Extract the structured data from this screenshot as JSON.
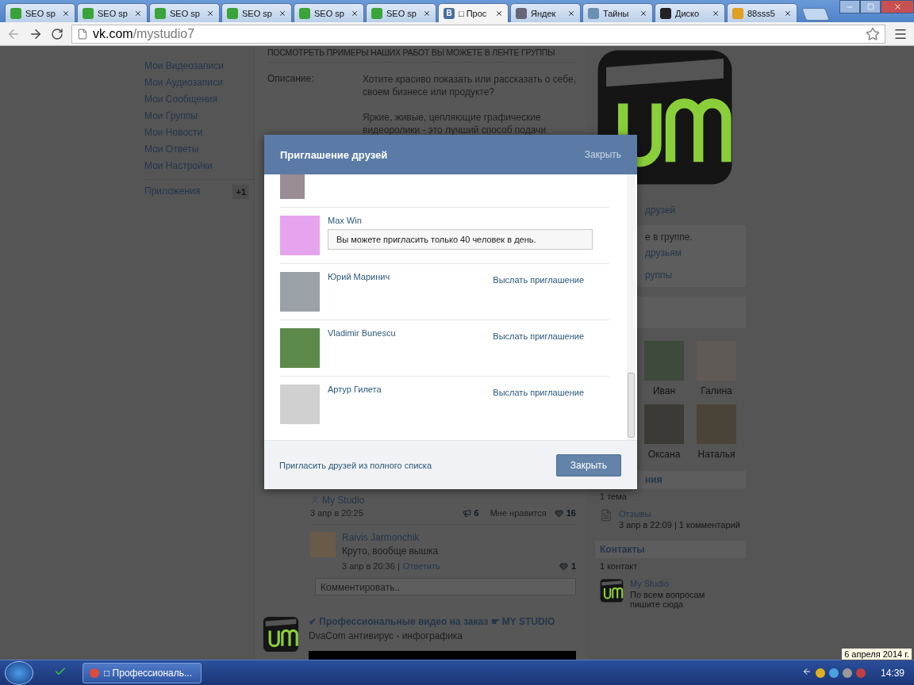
{
  "browser": {
    "tabs": [
      {
        "title": "SEO sp",
        "selected": false
      },
      {
        "title": "SEO sp",
        "selected": false
      },
      {
        "title": "SEO sp",
        "selected": false
      },
      {
        "title": "SEO sp",
        "selected": false
      },
      {
        "title": "SEO sp",
        "selected": false
      },
      {
        "title": "SEO sp",
        "selected": false
      },
      {
        "title": "□ Прос",
        "icon_text": "В",
        "selected": true
      },
      {
        "title": "Яндек",
        "selected": false
      },
      {
        "title": "Тайны",
        "selected": false
      },
      {
        "title": "Диско",
        "selected": false
      },
      {
        "title": "88sss5",
        "selected": false
      }
    ],
    "url_host": "vk.com",
    "url_path": "/mystudio7"
  },
  "sidebar": {
    "items": [
      "Мои Видеозаписи",
      "Мои Аудиозаписи",
      "Мои Сообщения",
      "Мои Группы",
      "Мои Новости",
      "Мои Ответы",
      "Мои Настройки"
    ],
    "apps": {
      "label": "Приложения",
      "badge": "+1"
    }
  },
  "group_info": {
    "banner": "ПОСМОТРЕТЬ ПРИМЕРЫ НАШИХ РАБОТ ВЫ МОЖЕТЕ В ЛЕНТЕ ГРУППЫ",
    "description_label": "Описание:",
    "description": [
      "Хотите красиво показать или рассказать о себе, своем бизнесе или продукте?",
      "Яркие, живые, цепляющие графические видеоролики - это лучший способ подачи"
    ]
  },
  "wall": {
    "post": {
      "author": "My Studio",
      "date": "3 апр в 20:25",
      "shares": "6",
      "like_label": "Мне нравится",
      "likes": "16",
      "comments": [
        {
          "author": "Raivis Jarmonchik",
          "text": "Круто, вообще вышка",
          "date": "3 апр в 20:36 |",
          "reply": "Ответить",
          "likes": "1"
        }
      ],
      "comment_placeholder": "Комментировать.."
    },
    "next_post": {
      "title": "✔ Профессиональные видео на заказ ☛ MY STUDIO",
      "text": "DvaCom антивирус - инфографика"
    }
  },
  "right_column": {
    "friends_link": "друзей",
    "membership": [
      "е в группе.",
      "друзьям",
      "руппы"
    ],
    "members": [
      {
        "name": "Иван"
      },
      {
        "name": "Галина"
      },
      {
        "name": "Оксана"
      },
      {
        "name": "Наталья"
      }
    ],
    "discussions": {
      "header": "ния",
      "count": "1 тема",
      "topics": [
        {
          "title": "Отзывы",
          "meta": "3 апр в 22:09 | 1 комментарий"
        }
      ]
    },
    "contacts": {
      "header": "Контакты",
      "count": "1 контакт",
      "items": [
        {
          "name": "My Studio",
          "note": "По всем вопросам пишите сюда"
        }
      ]
    }
  },
  "dialog": {
    "title": "Приглашение друзей",
    "header_close": "Закрыть",
    "friends": [
      {
        "kind": "cut"
      },
      {
        "kind": "limit",
        "name": "Max Win",
        "notice": "Вы можете пригласить только 40 человек в день."
      },
      {
        "kind": "invite",
        "name": "Юрий Маринич",
        "action": "Выслать приглашение"
      },
      {
        "kind": "invite",
        "name": "Vladimir Bunescu",
        "action": "Выслать приглашение"
      },
      {
        "kind": "invite",
        "name": "Артур Гилета",
        "action": "Выслать приглашение"
      }
    ],
    "footer_link": "Пригласить друзей из полного списка",
    "close_button": "Закрыть"
  },
  "taskbar": {
    "tasks": [
      {
        "title": "□ Профессиональ...",
        "selected": true
      }
    ],
    "clock": "14:39",
    "date_tooltip": "6 апреля 2014 г."
  }
}
